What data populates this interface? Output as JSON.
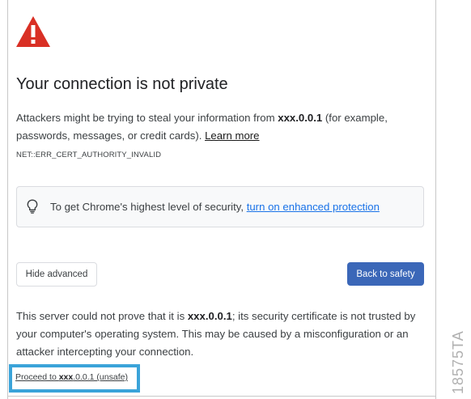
{
  "page": {
    "title": "Your connection is not private",
    "message": {
      "part1": "Attackers might be trying to steal your information from ",
      "host": "xxx.0.0.1",
      "part2": " (for example, passwords, messages, or credit cards). ",
      "learn_more": "Learn more"
    },
    "error_code": "NET::ERR_CERT_AUTHORITY_INVALID",
    "enhanced": {
      "text": "To get Chrome's highest level of security, ",
      "link": "turn on enhanced protection"
    },
    "buttons": {
      "hide_advanced": "Hide advanced",
      "back_to_safety": "Back to safety"
    },
    "advanced": {
      "part1": "This server could not prove that it is ",
      "host": "xxx.0.0.1",
      "part2": "; its security certificate is not trusted by your computer's operating system. This may be caused by a misconfiguration or an attacker intercepting your connection."
    },
    "proceed": {
      "prefix": "Proceed to ",
      "host_bold": "xxx",
      "host_rest": ".0.0.1",
      "suffix": " (unsafe)"
    }
  },
  "figure_id": "18575TA",
  "colors": {
    "warning_red": "#d93025",
    "primary_blue": "#3b67b8",
    "highlight_border": "#3aa3d9",
    "link_blue": "#1a73e8"
  },
  "icons": {
    "warning": "warning-triangle-icon",
    "bulb": "lightbulb-icon"
  }
}
